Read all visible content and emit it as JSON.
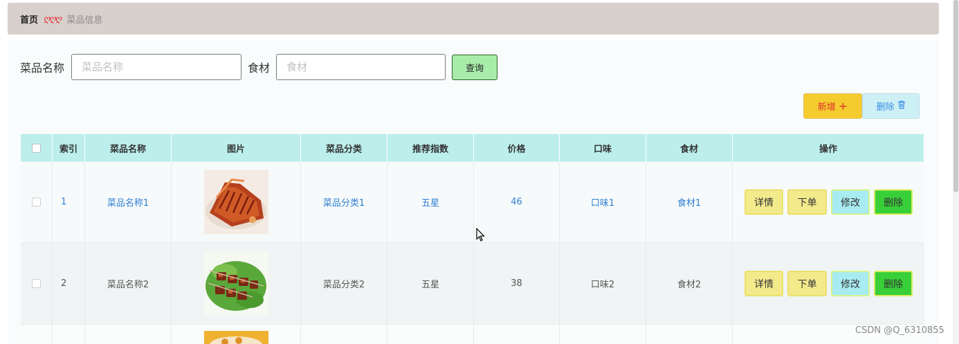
{
  "breadcrumb": {
    "home": "首页",
    "separator": "ღღღ",
    "current": "菜品信息"
  },
  "search": {
    "name_label": "菜品名称",
    "name_placeholder": "菜品名称",
    "ingredient_label": "食材",
    "ingredient_placeholder": "食材",
    "query_button": "查询"
  },
  "actions": {
    "add_label": "新增",
    "add_icon": "plus-icon",
    "delete_label": "删除",
    "delete_icon": "trash-icon"
  },
  "table": {
    "headers": [
      "索引",
      "菜品名称",
      "图片",
      "菜品分类",
      "推荐指数",
      "价格",
      "口味",
      "食材",
      "操作"
    ],
    "rows": [
      {
        "index": "1",
        "name": "菜品名称1",
        "category": "菜品分类1",
        "rating": "五星",
        "price": "46",
        "taste": "口味1",
        "ingredient": "食材1",
        "image": "roast-meat-image"
      },
      {
        "index": "2",
        "name": "菜品名称2",
        "category": "菜品分类2",
        "rating": "五星",
        "price": "38",
        "taste": "口味2",
        "ingredient": "食材2",
        "image": "kebab-skewer-image"
      }
    ],
    "row_buttons": {
      "detail": "详情",
      "order": "下单",
      "edit": "修改",
      "delete": "删除"
    }
  },
  "watermark": "CSDN @Q_6310855",
  "colors": {
    "breadcrumb_bg": "#d8d0cc",
    "table_header_bg": "#bcefec",
    "link": "#2f7fd3",
    "add_button": "#f5cc2e",
    "query_button": "#a8ecaa",
    "delete_button": "#39cf39"
  }
}
